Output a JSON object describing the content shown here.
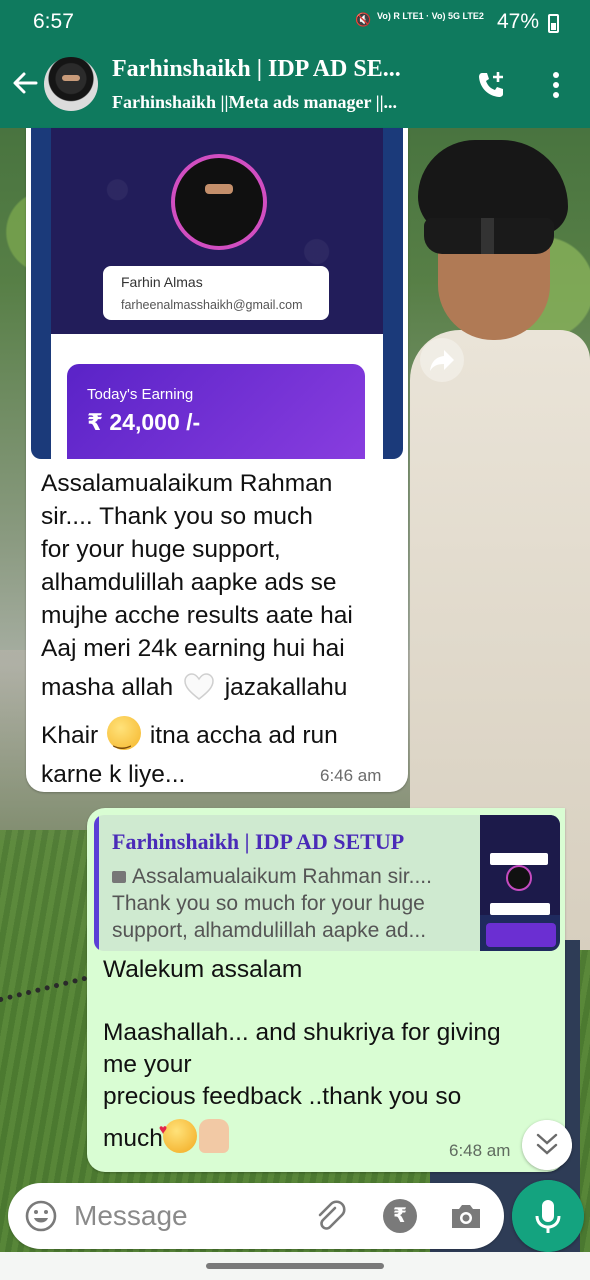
{
  "status_bar": {
    "time": "6:57",
    "network_line1": "Vo) R LTE1",
    "network_line2": "Vo) 5G LTE2",
    "battery": "47%"
  },
  "header": {
    "name": "Farhinshaikh | IDP AD SE...",
    "subtitle": "Farhinshaikh ||Meta ads manager ||...",
    "icons": [
      "back-arrow-icon",
      "add-call-icon",
      "more-options-icon"
    ]
  },
  "incoming": {
    "image": {
      "profile_name": "Farhin Almas",
      "profile_email": "farheenalmasshaikh@gmail.com",
      "earning_title": "Today's Earning",
      "earning_value": "₹ 24,000 /-"
    },
    "lines": [
      "Assalamualaikum Rahman",
      "sir.... Thank you so much",
      "for your huge support,",
      "alhamdulillah aapke ads se",
      "mujhe acche results aate hai",
      "Aaj meri 24k earning hui hai"
    ],
    "line7_a": "masha allah",
    "line7_b": "jazakallahu",
    "line8_a": "Khair",
    "line8_b": "itna accha ad run",
    "line9": "karne k liye...",
    "time": "6:46 am"
  },
  "outgoing": {
    "quote": {
      "author": "Farhinshaikh | IDP AD SETUP",
      "lines": [
        "Assalamualaikum Rahman sir....",
        "Thank you so much for your huge",
        "support, alhamdulillah aapke ad..."
      ]
    },
    "line1": "Walekum assalam",
    "line2": "Maashallah... and shukriya for giving",
    "line3": "me your",
    "line4": "precious feedback ..thank you so",
    "line5": "much",
    "time": "6:48 am"
  },
  "input": {
    "placeholder": "Message",
    "icons": [
      "emoji-icon",
      "attach-icon",
      "rupee-icon",
      "camera-icon",
      "mic-icon"
    ]
  }
}
